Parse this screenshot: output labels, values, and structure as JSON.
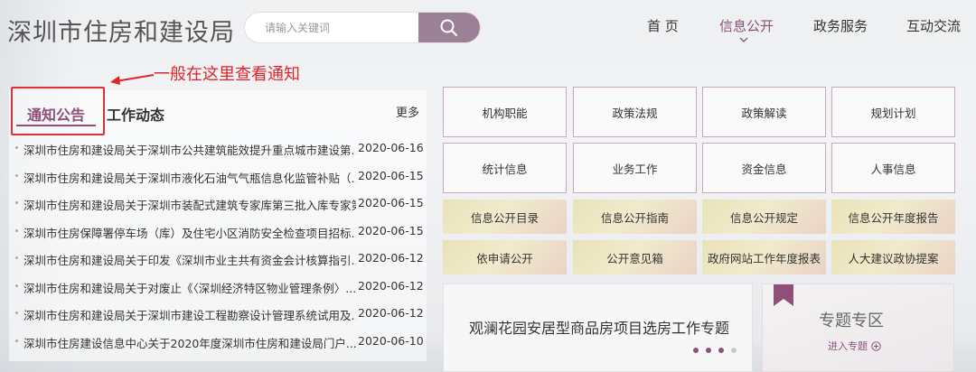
{
  "header": {
    "site_title": "深圳市住房和建设局",
    "search_placeholder": "请输入关键词"
  },
  "nav": {
    "items": [
      {
        "label": "首 页",
        "active": false
      },
      {
        "label": "信息公开",
        "active": true
      },
      {
        "label": "政务服务",
        "active": false
      },
      {
        "label": "互动交流",
        "active": false
      }
    ]
  },
  "annotation": {
    "text": "一般在这里查看通知"
  },
  "news_panel": {
    "tabs": [
      "通知公告",
      "工作动态"
    ],
    "active_tab": "通知公告",
    "more_label": "更多",
    "items": [
      {
        "title": "深圳市住房和建设局关于深圳市公共建筑能效提升重点城市建设第...",
        "date": "2020-06-16"
      },
      {
        "title": "深圳市住房和建设局关于深圳市液化石油气气瓶信息化监管补贴（...",
        "date": "2020-06-15"
      },
      {
        "title": "深圳市住房和建设局关于深圳市装配式建筑专家库第三批入库专家第...",
        "date": "2020-06-15"
      },
      {
        "title": "深圳市住房保障署停车场（库）及住宅小区消防安全检查项目招标...",
        "date": "2020-06-15"
      },
      {
        "title": "深圳市住房和建设局关于印发《深圳市业主共有资金会计核算指引...",
        "date": "2020-06-12"
      },
      {
        "title": "深圳市住房和建设局关于对废止《〈深圳经济特区物业管理条例〉...",
        "date": "2020-06-12"
      },
      {
        "title": "深圳市住房和建设局关于深圳市建设工程勘察设计管理系统试用及...",
        "date": "2020-06-12"
      },
      {
        "title": "深圳市住房建设信息中心关于2020年度深圳市住房和建设局门户...",
        "date": "2020-06-10"
      }
    ]
  },
  "info_grid": {
    "row1": [
      "机构职能",
      "政策法规",
      "政策解读",
      "规划计划"
    ],
    "row2": [
      "统计信息",
      "业务工作",
      "资金信息",
      "人事信息"
    ],
    "row3": [
      "信息公开目录",
      "信息公开指南",
      "信息公开规定",
      "信息公开年度报告"
    ],
    "row4": [
      "依申请公开",
      "公开意见箱",
      "政府网站工作年度报表",
      "人大建议政协提案"
    ]
  },
  "feature": {
    "title": "观澜花园安居型商品房项目选房工作专题",
    "carousel_count": 4,
    "carousel_active_count": 3
  },
  "special": {
    "title": "专题专区",
    "enter_label": "进入专题"
  },
  "colors": {
    "accent": "#8e4f79",
    "annotation_red": "#e0262b",
    "search_button": "#9c8196"
  }
}
